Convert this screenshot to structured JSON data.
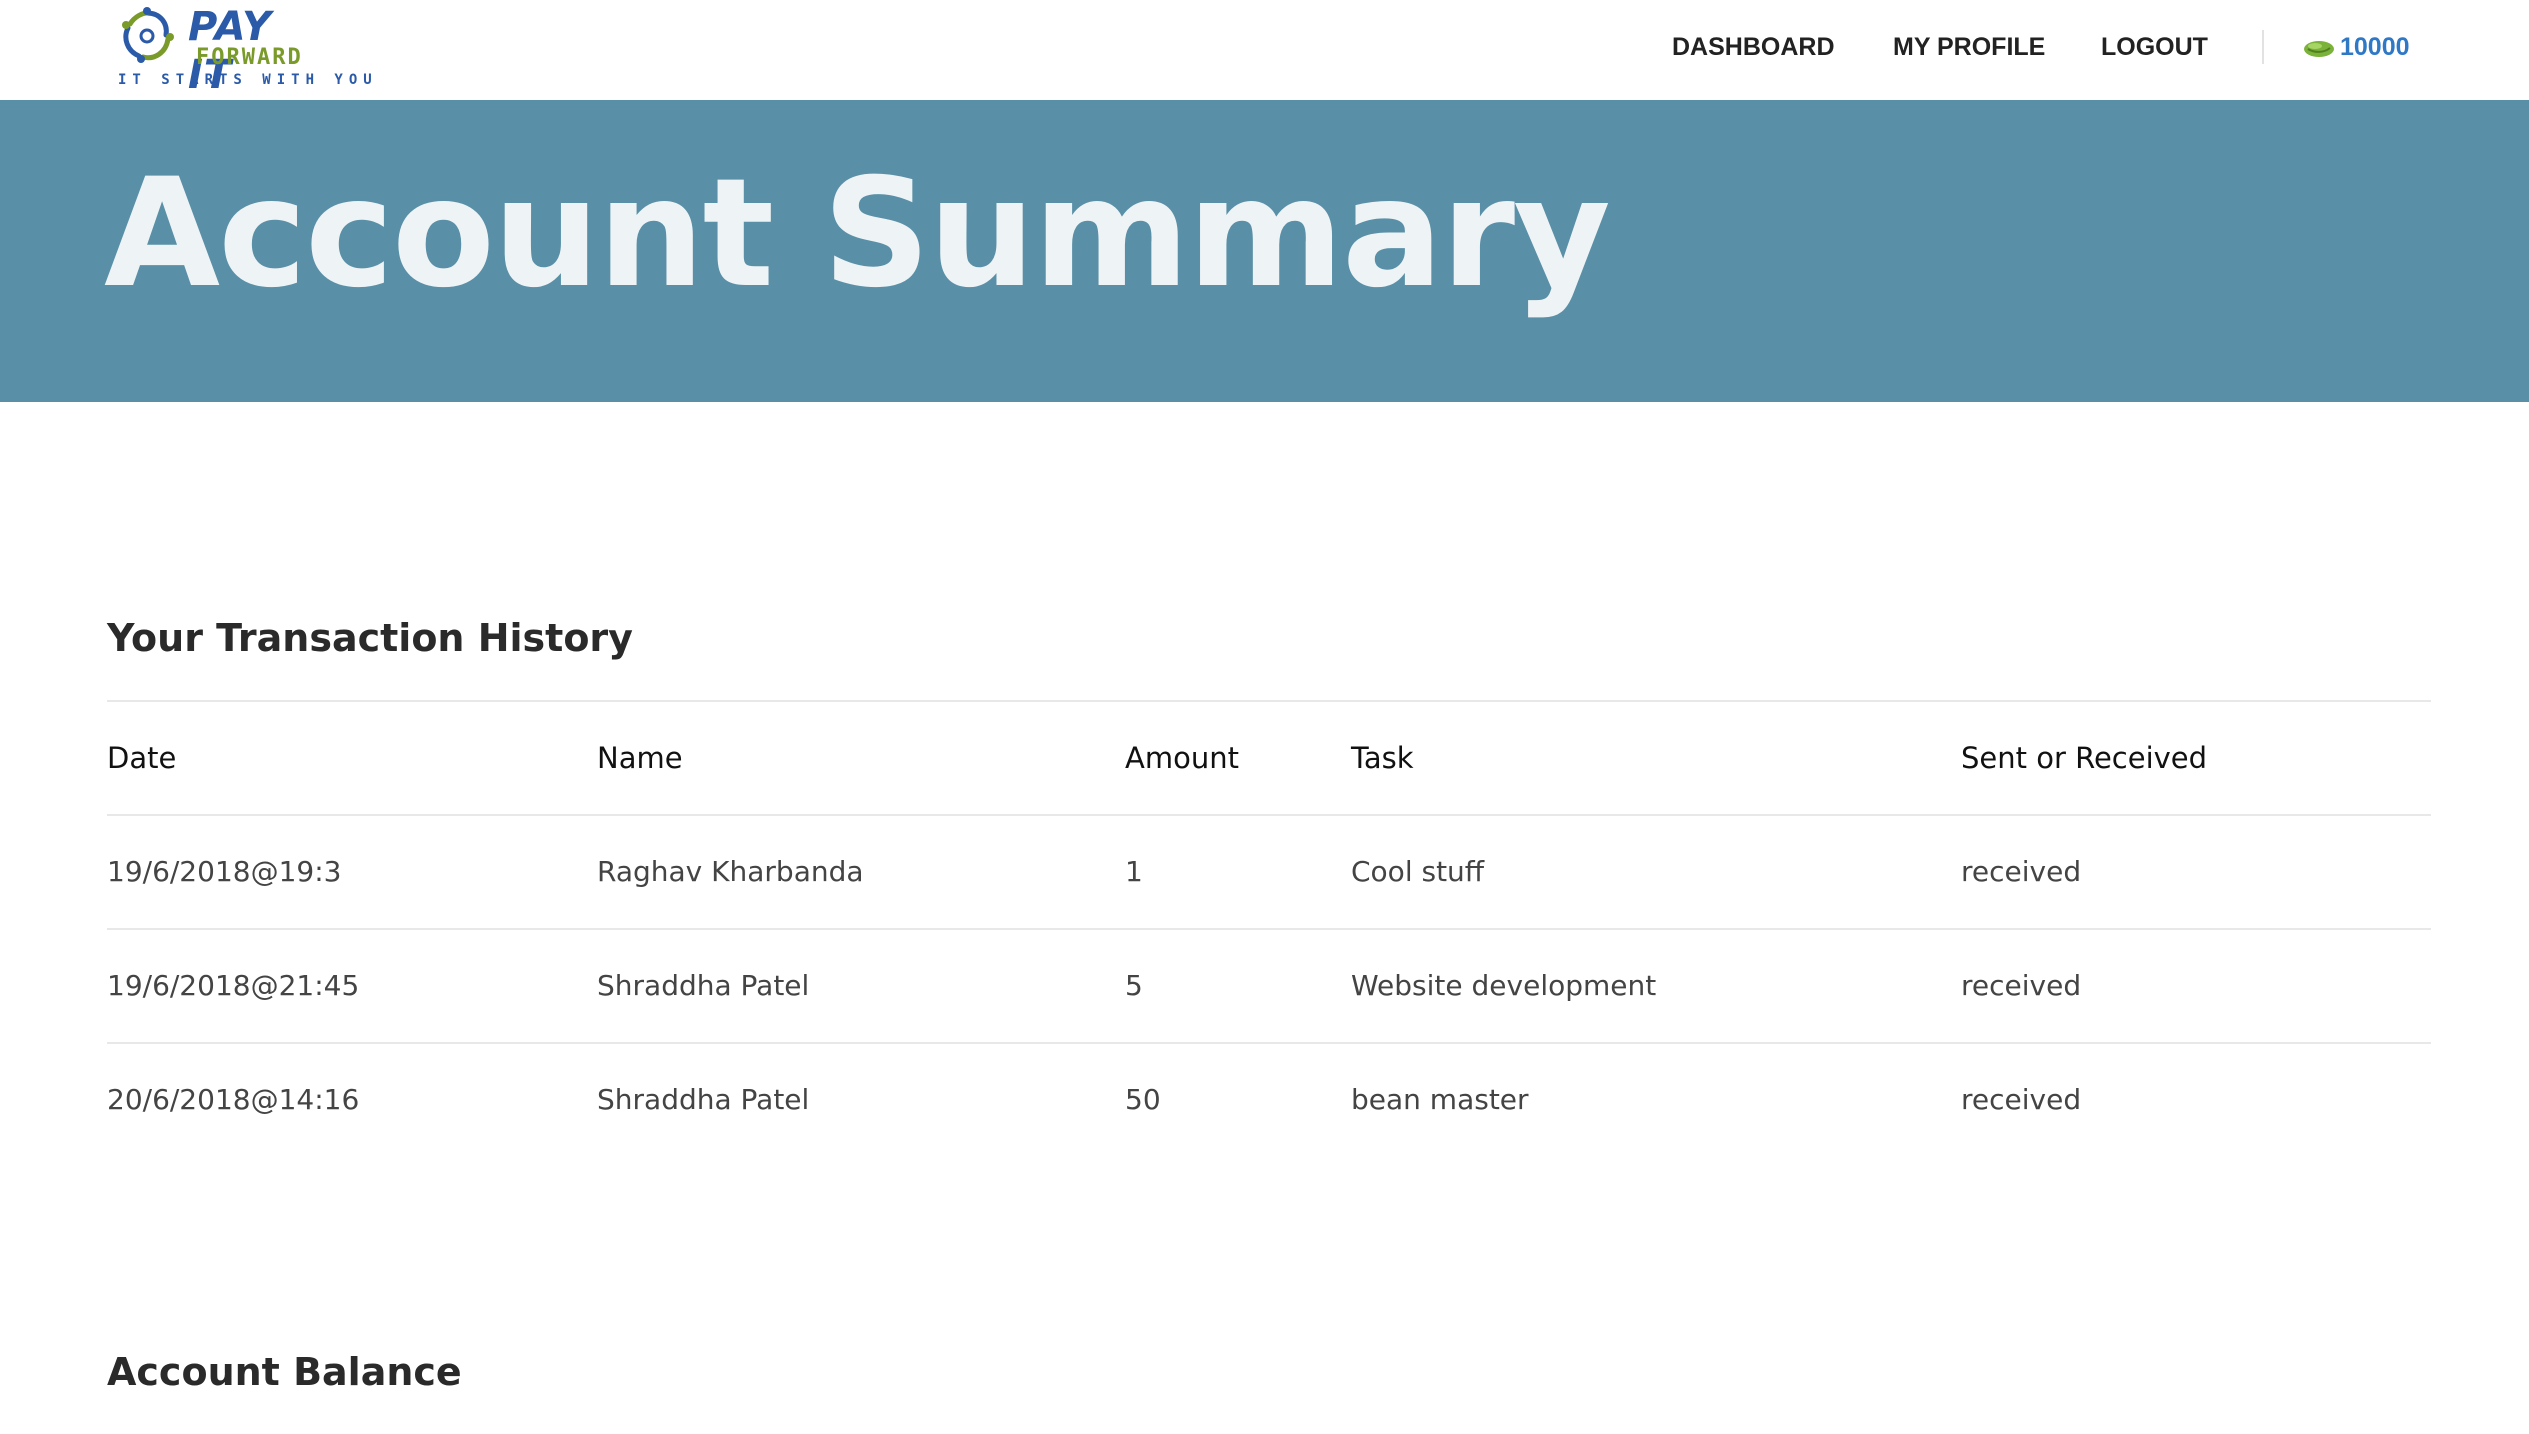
{
  "header": {
    "logo": {
      "brand_top": "PAY IT",
      "brand_mid": "FORWARD",
      "tagline": "IT STARTS WITH YOU"
    },
    "nav": {
      "dashboard": "DASHBOARD",
      "profile": "MY PROFILE",
      "logout": "LOGOUT"
    },
    "beans": {
      "icon": "bean-icon",
      "count": "10000"
    }
  },
  "hero": {
    "title": "Account Summary"
  },
  "history": {
    "title": "Your Transaction History",
    "columns": [
      "Date",
      "Name",
      "Amount",
      "Task",
      "Sent or Received"
    ],
    "rows": [
      [
        "19/6/2018@19:3",
        "Raghav Kharbanda",
        "1",
        "Cool stuff",
        "received"
      ],
      [
        "19/6/2018@21:45",
        "Shraddha Patel",
        "5",
        "Website development",
        "received"
      ],
      [
        "20/6/2018@14:16",
        "Shraddha Patel",
        "50",
        "bean master",
        "received"
      ]
    ]
  },
  "balance": {
    "title": "Account Balance"
  },
  "colors": {
    "hero_bg": "#5990a7",
    "hero_text": "#eef3f6",
    "bean_count": "#2f78c6",
    "logo_blue": "#2a5aa8",
    "logo_green": "#7a9a2a"
  }
}
